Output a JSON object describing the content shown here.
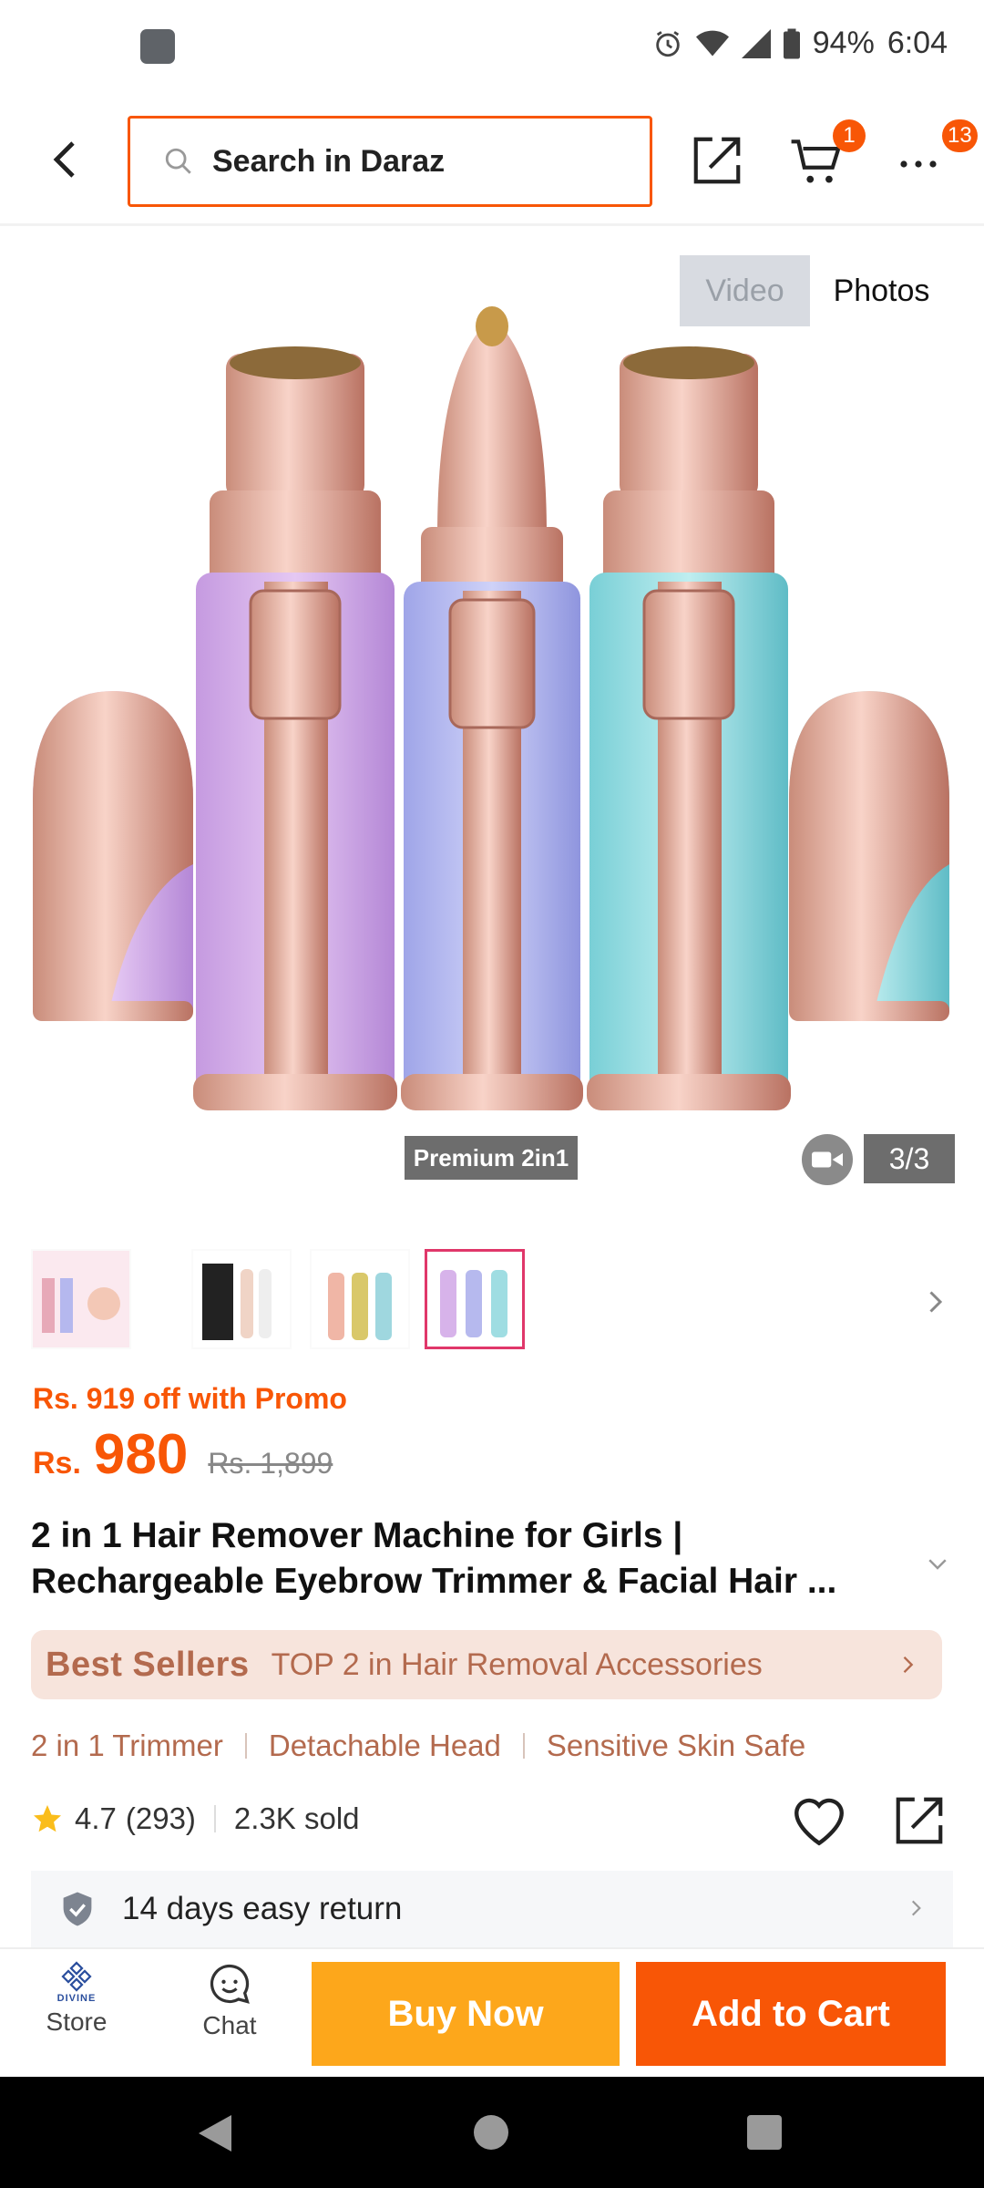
{
  "status_bar": {
    "battery": "94%",
    "time": "6:04"
  },
  "header": {
    "search_placeholder": "Search in Daraz",
    "cart_count": "1",
    "more_count": "13"
  },
  "gallery": {
    "video_tab": "Video",
    "photos_tab": "Photos",
    "caption": "Premium 2in1",
    "counter": "3/3"
  },
  "price": {
    "promo": "Rs. 919 off with Promo",
    "currency": "Rs.",
    "current": "980",
    "original": "Rs. 1,899"
  },
  "product": {
    "title": "2 in 1 Hair Remover Machine for Girls | Rechargeable Eyebrow Trimmer & Facial Hair ..."
  },
  "best_sellers": {
    "label": "Best Sellers",
    "rank": "TOP 2 in Hair Removal Accessories"
  },
  "features": [
    "2 in 1 Trimmer",
    "Detachable Head",
    "Sensitive Skin Safe"
  ],
  "rating": {
    "score": "4.7",
    "count": "(293)",
    "sold": "2.3K sold"
  },
  "return_policy": "14 days easy return",
  "actions": {
    "store_logo_text": "DIVINE",
    "store": "Store",
    "chat": "Chat",
    "buy_now": "Buy Now",
    "add_to_cart": "Add to Cart"
  },
  "colors": {
    "accent": "#f85606",
    "buy": "#fda71b",
    "bestseller_bg": "#f7e4dc",
    "bestseller_text": "#b36a4e"
  }
}
